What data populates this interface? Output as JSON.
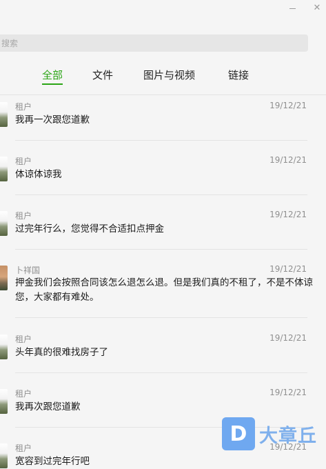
{
  "window": {
    "minimize_label": "",
    "close_label": "✕"
  },
  "search": {
    "placeholder": "搜索"
  },
  "tabs": [
    {
      "label": "全部",
      "active": true
    },
    {
      "label": "文件",
      "active": false
    },
    {
      "label": "图片与视频",
      "active": false
    },
    {
      "label": "链接",
      "active": false
    }
  ],
  "messages": [
    {
      "sender": "租户",
      "date": "19/12/21",
      "text": "我再一次跟您道歉"
    },
    {
      "sender": "租户",
      "date": "19/12/21",
      "text": "体谅体谅我"
    },
    {
      "sender": "租户",
      "date": "19/12/21",
      "text": "过完年行么，您觉得不合适扣点押金"
    },
    {
      "sender": "卜祥国",
      "date": "19/12/21",
      "text": "押金我们会按照合同该怎么退怎么退。但是我们真的不租了，不是不体谅您，大家都有难处。"
    },
    {
      "sender": "租户",
      "date": "19/12/21",
      "text": "头年真的很难找房子了"
    },
    {
      "sender": "租户",
      "date": "19/12/21",
      "text": "我再次跟您道歉"
    },
    {
      "sender": "租户",
      "date": "19/12/21",
      "text": "宽容到过完年行吧"
    }
  ],
  "watermark": {
    "logo_letter": "D",
    "text": "大章丘"
  },
  "colors": {
    "accent": "#2aa515",
    "watermark": "#6fa8f0"
  }
}
